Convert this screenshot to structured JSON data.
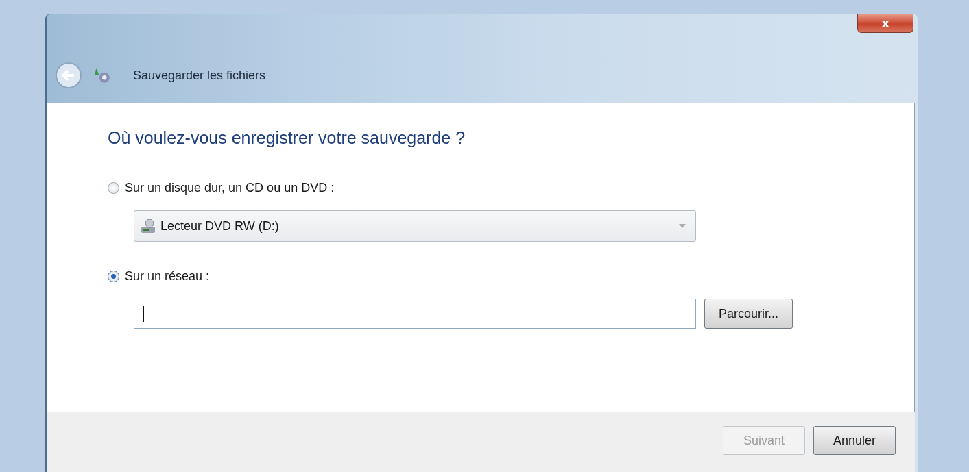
{
  "window": {
    "title": "Sauvegarder les fichiers",
    "close_label": "x"
  },
  "heading": "Où voulez-vous enregistrer votre sauvegarde ?",
  "options": [
    {
      "kind": "drive",
      "label": "Sur un disque dur, un CD ou un DVD :",
      "selected": false,
      "dropdown_value": "Lecteur DVD RW (D:)"
    },
    {
      "kind": "network",
      "label": "Sur un réseau :",
      "selected": true,
      "browse_label": "Parcourir..."
    }
  ],
  "buttons": [
    {
      "label": "Suivant",
      "disabled": true
    },
    {
      "label": "Annuler",
      "disabled": false
    }
  ]
}
